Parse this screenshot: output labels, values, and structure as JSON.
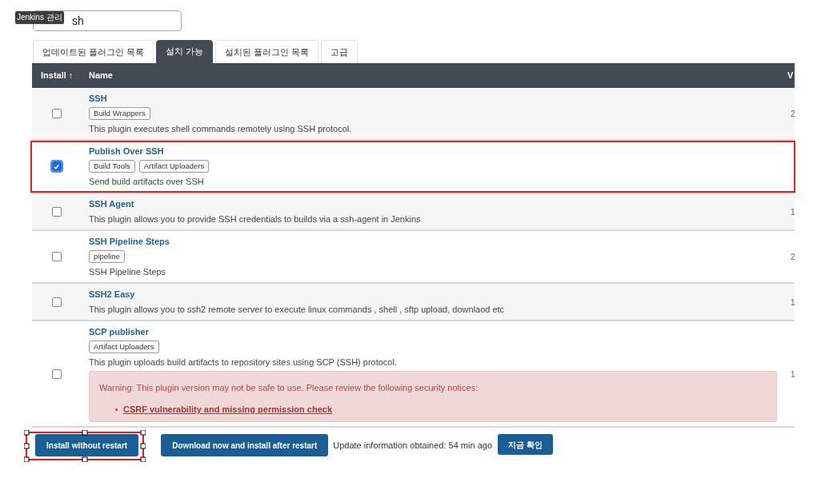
{
  "search": {
    "value": "sh"
  },
  "tooltip": "Jenkins 관리",
  "tabs": [
    {
      "label": "업데이트된 플러그인 목록",
      "selected": false
    },
    {
      "label": "설치 가능",
      "selected": true
    },
    {
      "label": "설치된 플러그인 목록",
      "selected": false
    },
    {
      "label": "고급",
      "selected": false
    }
  ],
  "table": {
    "columns": [
      "Install ↑",
      "Name",
      "V"
    ],
    "rows": [
      {
        "name": "SSH",
        "tags": [
          "Build Wrappers"
        ],
        "description": "This plugin executes shell commands remotely using SSH protocol.",
        "checked": false,
        "highlighted": false,
        "version": "2"
      },
      {
        "name": "Publish Over SSH",
        "tags": [
          "Build Tools",
          "Artifact Uploaders"
        ],
        "description": "Send build artifacts over SSH",
        "checked": true,
        "highlighted": true
      },
      {
        "name": "SSH Agent",
        "description": "This plugin allows you to provide SSH credentials to builds via a ssh-agent in Jenkins",
        "checked": false,
        "highlighted": false,
        "version": "1"
      },
      {
        "name": "SSH Pipeline Steps",
        "tags": [
          "pipeline"
        ],
        "description": "SSH Pipeline Steps",
        "checked": false,
        "highlighted": false,
        "version": "2"
      },
      {
        "name": "SSH2 Easy",
        "description": "This plugin allows you to ssh2 remote server to execute linux commands , shell , sftp upload, downlaod etc",
        "checked": false,
        "highlighted": false,
        "version": "1"
      },
      {
        "name": "SCP publisher",
        "tags": [
          "Artifact Uploaders"
        ],
        "description": "This plugin uploads build artifacts to repository sites using SCP (SSH) protocol.",
        "checked": false,
        "highlighted": false,
        "version": "1",
        "warning": {
          "text": "Warning: This plugin version may not be safe to use. Please review the following security notices:",
          "links": [
            "CSRF vulnerability and missing permission check"
          ]
        }
      }
    ]
  },
  "footer": {
    "buttons": [
      {
        "label": "Install without restart",
        "annotated": true
      },
      {
        "label": "Download now and install after restart",
        "annotated": false
      }
    ],
    "status": "Update information obtained: 54 min ago",
    "check_button": "지금 확인"
  }
}
